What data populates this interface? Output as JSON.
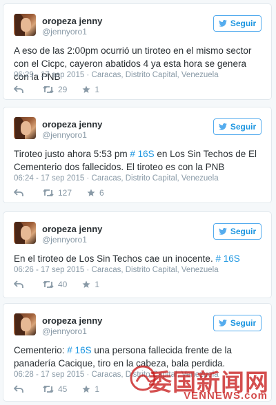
{
  "follow_label": "Seguir",
  "tweets": [
    {
      "name": "oropeza jenny",
      "handle": "@jennyoro1",
      "text_parts": [
        "A eso de las 2:00pm ocurrió un tiroteo en el mismo sector con el Cicpc, cayeron abatidos 4 ya esta hora se genera con la PNB"
      ],
      "meta": "06:29 - 17 sep 2015 · Caracas, Distrito Capital, Venezuela",
      "retweets": "29",
      "likes": "1"
    },
    {
      "name": "oropeza jenny",
      "handle": "@jennyoro1",
      "text_parts": [
        "Tiroteo justo ahora 5:53 pm ",
        "# 16S",
        " en Los Sin Techos de El Cementerio dos fallecidos. El tiroteo es con la PNB"
      ],
      "meta": "06:24 - 17 sep 2015 · Caracas, Distrito Capital, Venezuela",
      "retweets": "127",
      "likes": "6"
    },
    {
      "name": "oropeza jenny",
      "handle": "@jennyoro1",
      "text_parts": [
        "En el tiroteo de Los Sin Techos cae un inocente. ",
        "# 16S"
      ],
      "meta": "06:26 - 17 sep 2015 · Caracas, Distrito Capital, Venezuela",
      "retweets": "40",
      "likes": "1"
    },
    {
      "name": "oropeza jenny",
      "handle": "@jennyoro1",
      "text_parts": [
        "Cementerio: ",
        "# 16S",
        " una persona fallecida frente de la panadería Cacique, tiro en la cabeza, bala perdida."
      ],
      "meta": "06:28 - 17 sep 2015 · Caracas, Distrito Capital, Venezuela",
      "retweets": "45",
      "likes": "1"
    }
  ],
  "watermark": {
    "cn": "委国新闻网",
    "en": "VENNEWS.com"
  },
  "colors": {
    "link": "#1b95e0",
    "muted": "#8899a6",
    "border": "#e1e8ed",
    "watermark": "#c81e1e"
  }
}
